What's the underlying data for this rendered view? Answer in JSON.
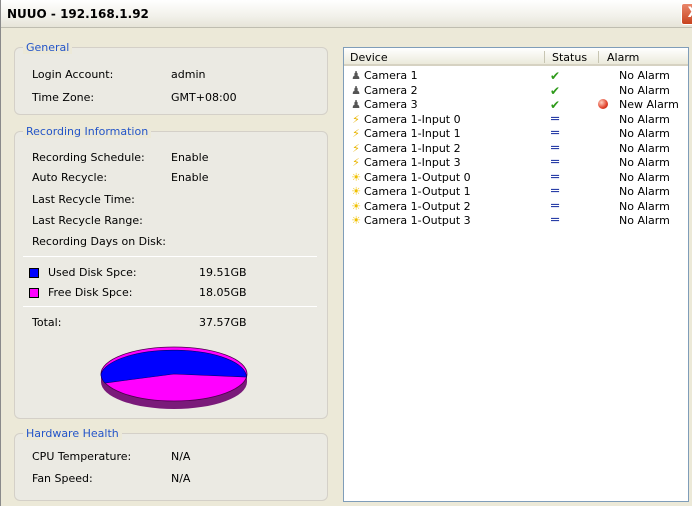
{
  "window": {
    "title": "NUUO - 192.168.1.92",
    "close_label": "X"
  },
  "general": {
    "legend": "General",
    "login_label": "Login Account:",
    "login_value": "admin",
    "tz_label": "Time Zone:",
    "tz_value": "GMT+08:00"
  },
  "recording": {
    "legend": "Recording Information",
    "schedule_label": "Recording Schedule:",
    "schedule_value": "Enable",
    "auto_label": "Auto Recycle:",
    "auto_value": "Enable",
    "last_time_label": "Last Recycle Time:",
    "last_range_label": "Last Recycle Range:",
    "days_label": "Recording Days on Disk:",
    "used_label": "Used Disk Spce:",
    "used_value": "19.51GB",
    "used_color": "#0000ff",
    "free_label": "Free Disk Spce:",
    "free_value": "18.05GB",
    "free_color": "#ff00ff",
    "total_label": "Total:",
    "total_value": "37.57GB"
  },
  "disk_usage": {
    "used_gb": 19.51,
    "free_gb": 18.05
  },
  "hardware": {
    "legend": "Hardware Health",
    "cpu_label": "CPU Temperature:",
    "cpu_value": "N/A",
    "fan_label": "Fan Speed:",
    "fan_value": "N/A"
  },
  "device_list": {
    "headers": {
      "device": "Device",
      "status": "Status",
      "alarm": "Alarm"
    },
    "rows": [
      {
        "name": "Camera 1",
        "icon": "camera-icon",
        "status": "check-icon",
        "status_glyph": "✔",
        "alarm": "No Alarm"
      },
      {
        "name": "Camera 2",
        "icon": "camera-icon",
        "status": "check-icon",
        "status_glyph": "✔",
        "alarm": "No Alarm"
      },
      {
        "name": "Camera 3",
        "icon": "camera-icon",
        "status": "check-icon",
        "status_glyph": "✔",
        "alarm": "New Alarm",
        "alarm_icon": "alarm-dot-icon"
      },
      {
        "name": "Camera 1-Input 0",
        "icon": "input-icon",
        "status": "idle-icon",
        "status_glyph": "═",
        "alarm": "No Alarm"
      },
      {
        "name": "Camera 1-Input 1",
        "icon": "input-icon",
        "status": "idle-icon",
        "status_glyph": "═",
        "alarm": "No Alarm"
      },
      {
        "name": "Camera 1-Input 2",
        "icon": "input-icon",
        "status": "idle-icon",
        "status_glyph": "═",
        "alarm": "No Alarm"
      },
      {
        "name": "Camera 1-Input 3",
        "icon": "input-icon",
        "status": "idle-icon",
        "status_glyph": "═",
        "alarm": "No Alarm"
      },
      {
        "name": "Camera 1-Output 0",
        "icon": "output-icon",
        "status": "idle-icon",
        "status_glyph": "═",
        "alarm": "No Alarm"
      },
      {
        "name": "Camera 1-Output 1",
        "icon": "output-icon",
        "status": "idle-icon",
        "status_glyph": "═",
        "alarm": "No Alarm"
      },
      {
        "name": "Camera 1-Output 2",
        "icon": "output-icon",
        "status": "idle-icon",
        "status_glyph": "═",
        "alarm": "No Alarm"
      },
      {
        "name": "Camera 1-Output 3",
        "icon": "output-icon",
        "status": "idle-icon",
        "status_glyph": "═",
        "alarm": "No Alarm"
      }
    ]
  }
}
